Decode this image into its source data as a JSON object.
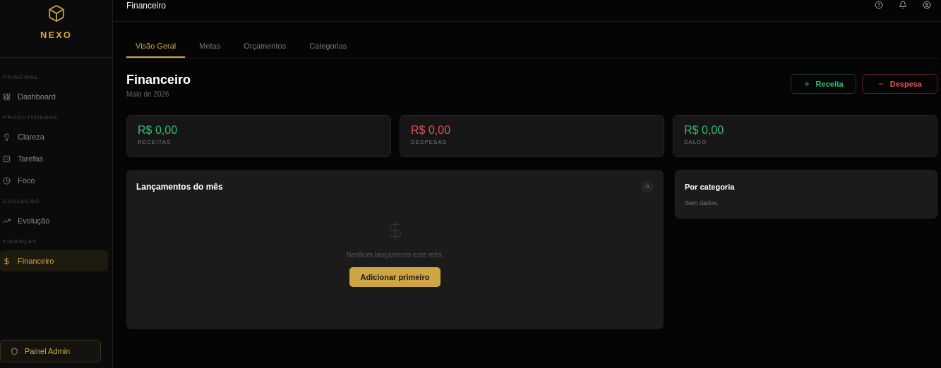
{
  "brand": {
    "name": "NEXO"
  },
  "sidebar": {
    "sections": [
      {
        "title": "PRINCIPAL",
        "items": [
          {
            "label": "Dashboard",
            "kind": "grid",
            "selected": false
          }
        ]
      },
      {
        "title": "PRODUTIVIDADE",
        "items": [
          {
            "label": "Clareza",
            "kind": "bulb",
            "selected": false
          },
          {
            "label": "Tarefas",
            "kind": "check",
            "selected": false
          },
          {
            "label": "Foco",
            "kind": "clock",
            "selected": false
          }
        ]
      },
      {
        "title": "EVOLUÇÃO",
        "items": [
          {
            "label": "Evolução",
            "kind": "trend",
            "selected": false
          }
        ]
      },
      {
        "title": "FINANÇAS",
        "items": [
          {
            "label": "Financeiro",
            "kind": "dollar",
            "selected": true
          }
        ]
      }
    ],
    "admin_button": "Painel Admin"
  },
  "header": {
    "title": "Financeiro"
  },
  "tabs": [
    {
      "label": "Visão Geral",
      "selected": true
    },
    {
      "label": "Metas",
      "selected": false
    },
    {
      "label": "Orçamentos",
      "selected": false
    },
    {
      "label": "Categorias",
      "selected": false
    }
  ],
  "page": {
    "title": "Financeiro",
    "subtitle": "Maio de 2026"
  },
  "actions": [
    {
      "label": "Receita",
      "kind": "income"
    },
    {
      "label": "Despesa",
      "kind": "expense"
    }
  ],
  "stats": [
    {
      "value": "R$ 0,00",
      "label": "RECEITAS",
      "color": "#2fbf71"
    },
    {
      "value": "R$ 0,00",
      "label": "DESPESAS",
      "color": "#e05252"
    },
    {
      "value": "R$ 0,00",
      "label": "SALDO",
      "color": "#2fbf71"
    }
  ],
  "entries": {
    "title": "Lançamentos do mês",
    "count": "0",
    "empty_text": "Nenhum lançamento este mês.",
    "add_button": "Adicionar primeiro"
  },
  "by_category": {
    "title": "Por categoria",
    "empty_text": "Sem dados."
  }
}
